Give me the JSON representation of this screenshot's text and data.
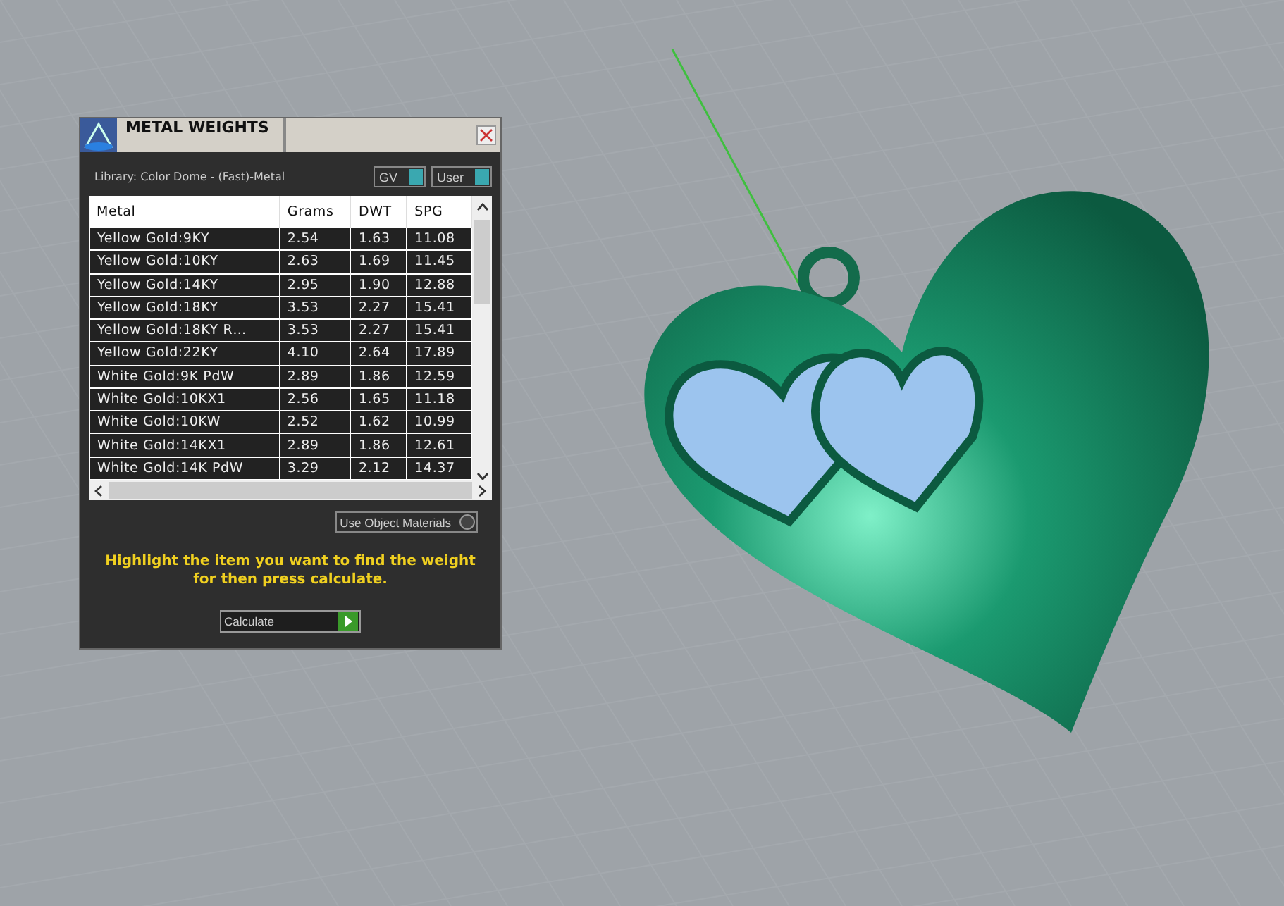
{
  "panel": {
    "title": "METAL WEIGHTS",
    "library": "Library: Color Dome - (Fast)-Metal",
    "toggles": [
      {
        "label": "GV",
        "on": true
      },
      {
        "label": "User",
        "on": true
      }
    ],
    "table": {
      "columns": [
        "Metal",
        "Grams",
        "DWT",
        "SPG"
      ],
      "rows": [
        {
          "cells": [
            "Yellow Gold:9KY",
            "2.54",
            "1.63",
            "11.08"
          ]
        },
        {
          "cells": [
            "Yellow Gold:10KY",
            "2.63",
            "1.69",
            "11.45"
          ]
        },
        {
          "cells": [
            "Yellow Gold:14KY",
            "2.95",
            "1.90",
            "12.88"
          ]
        },
        {
          "cells": [
            "Yellow Gold:18KY",
            "3.53",
            "2.27",
            "15.41"
          ]
        },
        {
          "cells": [
            "Yellow Gold:18KY R…",
            "3.53",
            "2.27",
            "15.41"
          ]
        },
        {
          "cells": [
            "Yellow Gold:22KY",
            "4.10",
            "2.64",
            "17.89"
          ]
        },
        {
          "cells": [
            "White Gold:9K PdW",
            "2.89",
            "1.86",
            "12.59"
          ]
        },
        {
          "cells": [
            "White Gold:10KX1",
            "2.56",
            "1.65",
            "11.18"
          ]
        },
        {
          "cells": [
            "White Gold:10KW",
            "2.52",
            "1.62",
            "10.99"
          ]
        },
        {
          "cells": [
            "White Gold:14KX1",
            "2.89",
            "1.86",
            "12.61"
          ]
        },
        {
          "cells": [
            "White Gold:14K PdW",
            "3.29",
            "2.12",
            "14.37"
          ]
        }
      ]
    },
    "object_materials": {
      "label": "Use Object Materials",
      "on": false
    },
    "hint": "Highlight the item you want to find the weight for then press calculate.",
    "calculate": "Calculate"
  }
}
